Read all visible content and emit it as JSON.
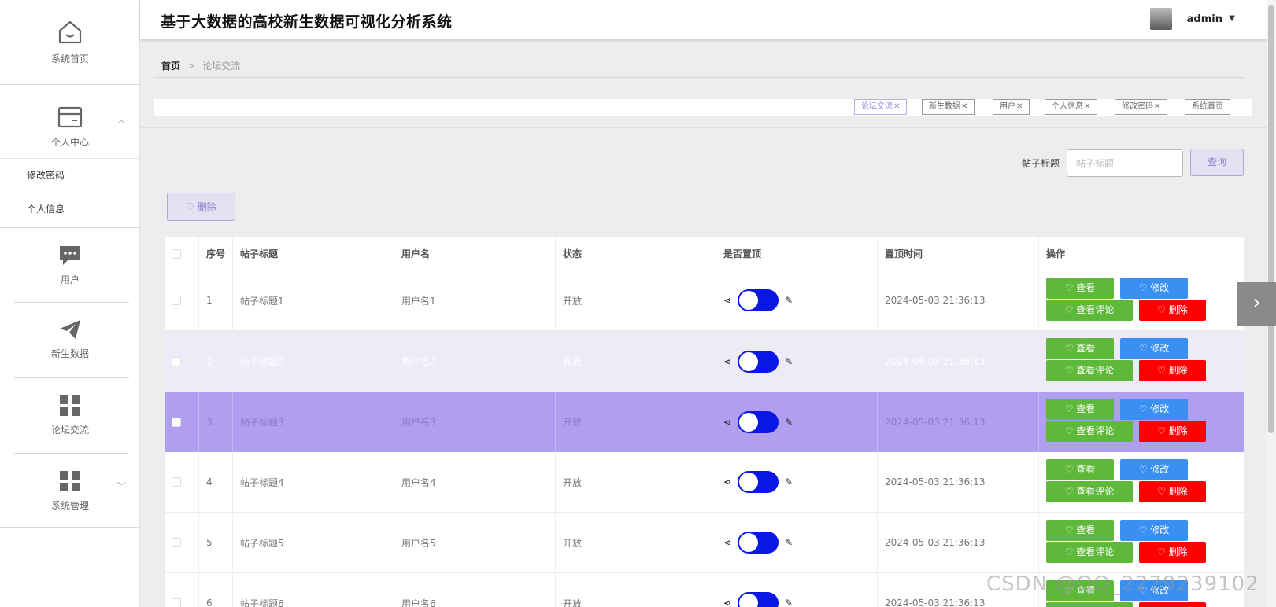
{
  "app": {
    "title": "基于大数据的高校新生数据可视化分析系统",
    "user": "admin"
  },
  "sidebar": {
    "home": "系统首页",
    "personal": "个人中心",
    "change_password": "修改密码",
    "personal_info": "个人信息",
    "users": "用户",
    "new_data": "新生数据",
    "forum": "论坛交流",
    "system": "系统管理"
  },
  "breadcrumb": {
    "home": "首页",
    "current": "论坛交流",
    "separator": ">"
  },
  "tags": [
    "论坛交流",
    "新生数据",
    "用户",
    "个人信息",
    "修改密码",
    "系统首页"
  ],
  "search": {
    "label": "帖子标题",
    "placeholder": "帖子标题",
    "button": "查询"
  },
  "toolbar": {
    "delete": "删除"
  },
  "table": {
    "headers": [
      "序号",
      "帖子标题",
      "用户名",
      "状态",
      "是否置顶",
      "置顶时间",
      "操作"
    ],
    "rows": [
      {
        "index": "1",
        "title": "帖子标题1",
        "user": "用户名1",
        "status": "开放",
        "time": "2024-05-03 21:36:13"
      },
      {
        "index": "2",
        "title": "帖子标题2",
        "user": "用户名2",
        "status": "开放",
        "time": "2024-05-03 21:36:13"
      },
      {
        "index": "3",
        "title": "帖子标题3",
        "user": "用户名3",
        "status": "开放",
        "time": "2024-05-03 21:36:13"
      },
      {
        "index": "4",
        "title": "帖子标题4",
        "user": "用户名4",
        "status": "开放",
        "time": "2024-05-03 21:36:13"
      },
      {
        "index": "5",
        "title": "帖子标题5",
        "user": "用户名5",
        "status": "开放",
        "time": "2024-05-03 21:36:13"
      },
      {
        "index": "6",
        "title": "帖子标题6",
        "user": "用户名6",
        "status": "开放",
        "time": "2024-05-03 21:36:13"
      }
    ],
    "actions": {
      "view": "查看",
      "edit": "修改",
      "comments": "查看评论",
      "delete": "删除"
    }
  },
  "watermark": "CSDN @QQ_2279239102",
  "colors": {
    "accent": "#8f82d1",
    "selected_row": "#b09ef0",
    "switch": "#0a16e6",
    "green": "#5eb83a",
    "blue": "#3a8ff2",
    "red": "#ff0000"
  }
}
